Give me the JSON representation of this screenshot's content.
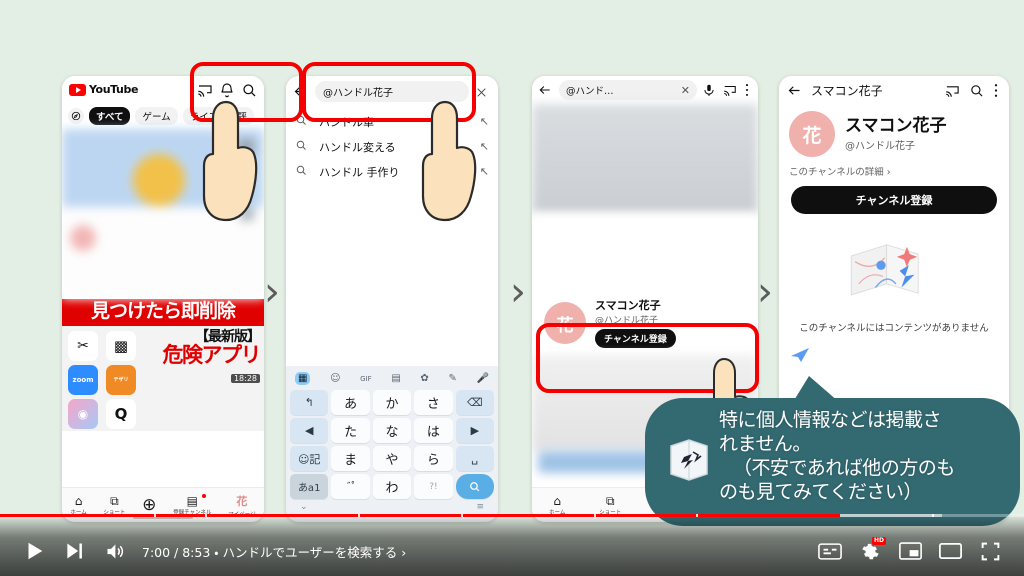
{
  "background_color": "#e3efe4",
  "accent_red": "#f50000",
  "bubble_color": "#336a72",
  "phone1": {
    "app_name": "YouTube",
    "icons": [
      "cast-icon",
      "bell-icon",
      "search-icon"
    ],
    "chips": [
      "すべて",
      "ゲーム",
      "ライブ",
      "評"
    ],
    "thumbnail": {
      "band_text": "見つけたら即削除",
      "title_top": "【最新版】",
      "title_main": "危険アプリ",
      "duration": "18:28",
      "app_icons": [
        "✂",
        "▩",
        "zoom",
        "テザリ",
        "◉",
        "Q"
      ]
    },
    "nav": [
      {
        "label": "ホーム",
        "icon": "home-icon"
      },
      {
        "label": "ショート",
        "icon": "shorts-icon"
      },
      {
        "label": "",
        "icon": "plus-icon"
      },
      {
        "label": "登録チャンネル",
        "icon": "subscriptions-icon"
      },
      {
        "label": "マイページ",
        "icon": "avatar-icon",
        "avatar_text": "花"
      }
    ]
  },
  "phone2": {
    "search_value": "@ハンドル花子",
    "suggestions": [
      "ハンドル車",
      "ハンドル変える",
      "ハンドル 手作り"
    ],
    "keyboard": {
      "toolbar": [
        "grid-icon",
        "sticker-icon",
        "GIF",
        "clipboard-icon",
        "gear-icon",
        "handwriting-icon",
        "mic-icon"
      ],
      "rows": [
        [
          "↰",
          "あ",
          "か",
          "さ",
          "⌫"
        ],
        [
          "◀",
          "た",
          "な",
          "は",
          "▶"
        ],
        [
          "☺記",
          "ま",
          "や",
          "ら",
          "␣"
        ],
        [
          "あa1",
          "˝˚",
          "わ",
          "?!",
          "🔍"
        ]
      ]
    }
  },
  "phone3": {
    "search_value": "@ハンド…",
    "icons": [
      "back-icon",
      "clear-icon",
      "mic-icon",
      "cast-icon",
      "more-icon"
    ],
    "channel": {
      "avatar_text": "花",
      "name": "スマコン花子",
      "handle": "@ハンドル花子",
      "subscribe_label": "チャンネル登録"
    },
    "nav": [
      "ホーム",
      "ショート",
      ""
    ]
  },
  "phone4": {
    "title": "スマコン花子",
    "icons": [
      "back-icon",
      "cast-icon",
      "search-icon",
      "more-icon"
    ],
    "channel": {
      "avatar_text": "花",
      "name": "スマコン花子",
      "handle": "@ハンドル花子",
      "details_link": "このチャンネルの詳細  ›",
      "subscribe_label": "チャンネル登録"
    },
    "empty_state_text": "このチャンネルにはコンテンツがありません"
  },
  "bubble": {
    "line1": "特に個人情報などは掲載さ",
    "line2": "れません。",
    "line3": "（不安であれば他の方のも",
    "line4": "のも見てみてください）",
    "icon": "book-icon"
  },
  "player": {
    "play_label": "play-button",
    "next_label": "next-button",
    "volume_label": "volume-button",
    "time_text": "7:00 / 8:53 ・ ハンドルでユーザーを検索する  ›",
    "quality_badge": "HD",
    "right_icons": [
      "captions-icon",
      "settings-icon",
      "miniplayer-icon",
      "theater-icon",
      "fullscreen-icon"
    ],
    "progress_percent": 82
  },
  "separators": [
    "›",
    "›",
    "›"
  ]
}
